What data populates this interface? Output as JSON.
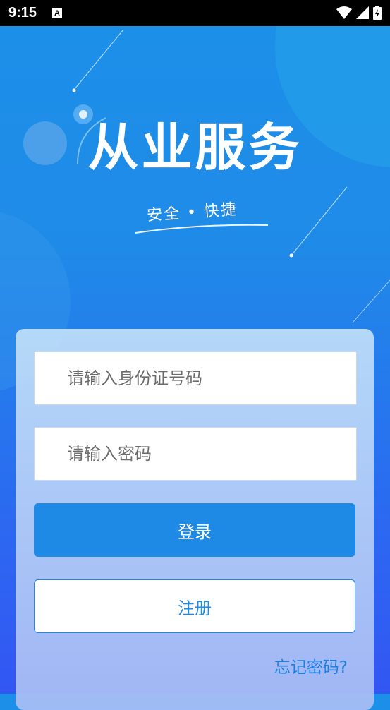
{
  "statusbar": {
    "time": "9:15",
    "notification_glyph": "A"
  },
  "header": {
    "title": "从业服务",
    "subtitle": "安全 • 快捷"
  },
  "form": {
    "id_placeholder": "请输入身份证号码",
    "password_placeholder": "请输入密码",
    "login_label": "登录",
    "register_label": "注册",
    "forgot_label": "忘记密码?"
  },
  "colors": {
    "primary": "#1e8ae6",
    "bg_top": "#1c90e9",
    "bg_bottom": "#3356f3"
  }
}
